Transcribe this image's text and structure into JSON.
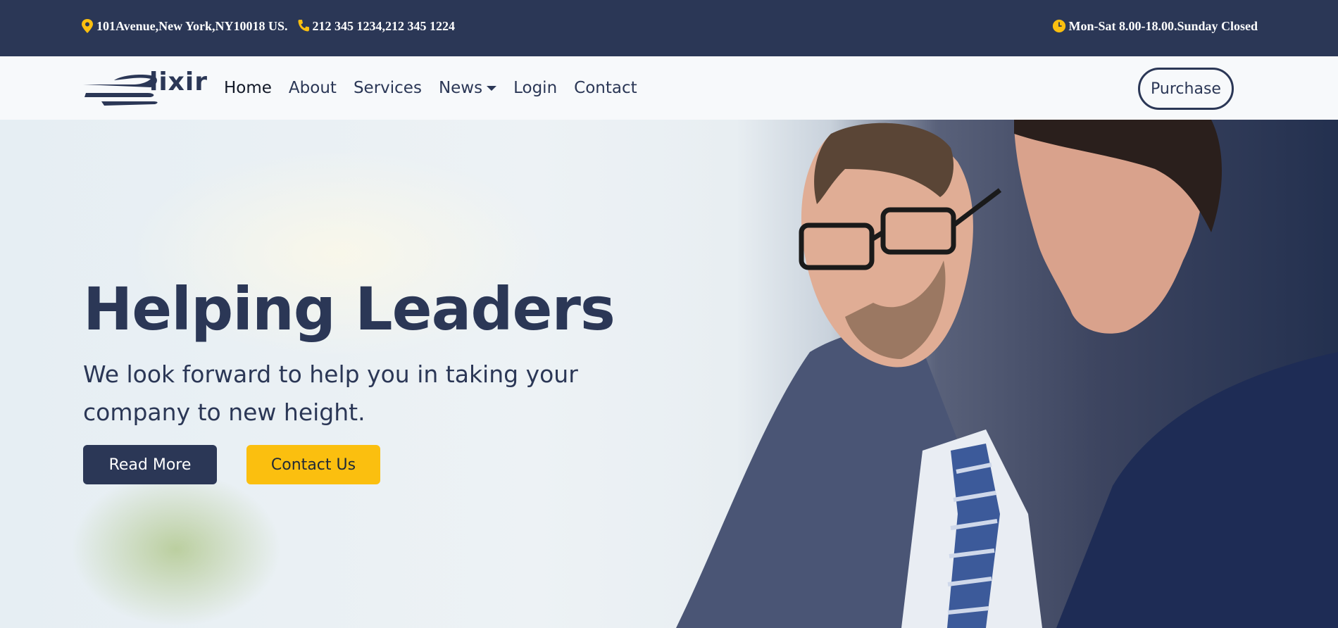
{
  "topbar": {
    "address": "101Avenue,New York,NY10018 US.",
    "phone": "212 345 1234,212 345 1224",
    "hours": "Mon-Sat 8.00-18.00.Sunday Closed",
    "accent_color": "#fbbf0f",
    "bg_color": "#2b3756"
  },
  "brand": {
    "logo_text": "lixir"
  },
  "nav": {
    "items": [
      {
        "label": "Home",
        "active": true
      },
      {
        "label": "About"
      },
      {
        "label": "Services"
      },
      {
        "label": "News",
        "dropdown": true
      },
      {
        "label": "Login"
      },
      {
        "label": "Contact"
      }
    ],
    "purchase_label": "Purchase"
  },
  "hero": {
    "title": "Helping Leaders",
    "subtitle": "We look forward to help you in taking your company to new height.",
    "read_more_label": "Read More",
    "contact_label": "Contact Us"
  },
  "icons": {
    "address": "map-pin-icon",
    "phone": "phone-icon",
    "hours": "clock-icon"
  }
}
